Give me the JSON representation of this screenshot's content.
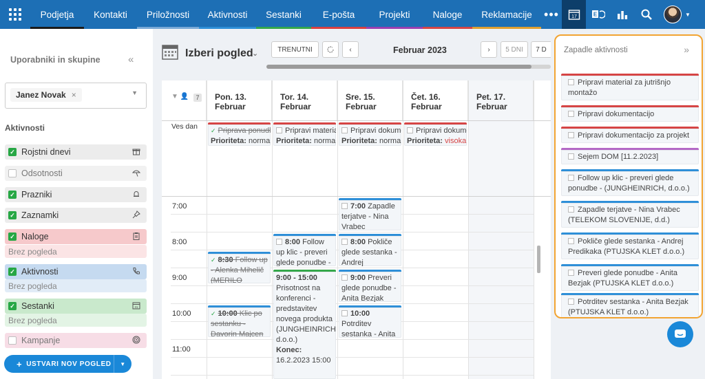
{
  "nav": {
    "items": [
      {
        "label": "Podjetja",
        "color": "#1a1a1a"
      },
      {
        "label": "Kontakti",
        "color": "#1d6fb5"
      },
      {
        "label": "Priložnosti",
        "color": "#7aa9d6"
      },
      {
        "label": "Aktivnosti",
        "color": "#2e8fd8"
      },
      {
        "label": "Sestanki",
        "color": "#35a84a"
      },
      {
        "label": "E-pošta",
        "color": "#d94040"
      },
      {
        "label": "Projekti",
        "color": "#9b3fb0"
      },
      {
        "label": "Naloge",
        "color": "#d64545"
      },
      {
        "label": "Reklamacije",
        "color": "#e0a030"
      }
    ],
    "more": "•••",
    "calendar_day": "17"
  },
  "sidebar": {
    "title": "Uporabniki in skupine",
    "collapse": "«",
    "selected_user": "Janez Novak",
    "remove": "×",
    "section": "Aktivnosti",
    "calendars": [
      {
        "label": "Rojstni dnevi",
        "checked": true,
        "icon": "gift-icon",
        "bg": "#ececec"
      },
      {
        "label": "Odsotnosti",
        "checked": false,
        "icon": "beach-umbrella-icon",
        "bg": "#f1f1f1"
      },
      {
        "label": "Prazniki",
        "checked": true,
        "icon": "bell-icon",
        "bg": "#ececec"
      },
      {
        "label": "Zaznamki",
        "checked": true,
        "icon": "pin-icon",
        "bg": "#ececec"
      },
      {
        "label": "Naloge",
        "checked": true,
        "icon": "clipboard-icon",
        "bg": "#f6c9cb",
        "sub": "Brez pogleda",
        "subbg": "#fbe4e5"
      },
      {
        "label": "Aktivnosti",
        "checked": true,
        "icon": "phone-icon",
        "bg": "#c5daf0",
        "sub": "Brez pogleda",
        "subbg": "#e1ecf7"
      },
      {
        "label": "Sestanki",
        "checked": true,
        "icon": "calendar-icon",
        "bg": "#c9e9cc",
        "sub": "Brez pogleda",
        "subbg": "#e3f4e5"
      },
      {
        "label": "Kampanje",
        "checked": false,
        "icon": "target-icon",
        "bg": "#f7dde6"
      }
    ],
    "new_view": "USTVARI NOV POGLED"
  },
  "main": {
    "view_title": "Izberi pogled",
    "today": "TRENUTNI",
    "month": "Februar 2023",
    "days_btn": "5 DNI",
    "seven_btn": "7 D",
    "user_count": "7",
    "all_day": "Ves dan",
    "days": [
      {
        "name": "Pon. 13.",
        "month": "Februar"
      },
      {
        "name": "Tor. 14.",
        "month": "Februar"
      },
      {
        "name": "Sre. 15.",
        "month": "Februar"
      },
      {
        "name": "Čet. 16.",
        "month": "Februar"
      },
      {
        "name": "Pet. 17.",
        "month": "Februar"
      }
    ],
    "times": [
      "7:00",
      "8:00",
      "9:00",
      "10:00",
      "11:00"
    ],
    "allday_events": [
      {
        "title": "Priprava ponudbe",
        "prio_label": "Prioriteta:",
        "prio": "normalna",
        "done": true
      },
      {
        "title": "Pripravi material",
        "prio_label": "Prioriteta:",
        "prio": "normalna",
        "done": false
      },
      {
        "title": "Pripravi dokumentacijo",
        "prio_label": "Prioriteta:",
        "prio": "normalna",
        "done": false
      },
      {
        "title": "Pripravi dokumentacijo",
        "prio_label": "Prioriteta:",
        "prio": "visoka",
        "done": false
      }
    ],
    "events": {
      "mon_830": {
        "time": "8:30",
        "text": "Follow up - Alenka Mihelič (MERILO"
      },
      "mon_1000": {
        "time": "10:00",
        "text": "Klic po sestanku - Davorin Majcen"
      },
      "tue_800": {
        "time": "8:00",
        "text": "Follow up klic - preveri glede ponudbe -"
      },
      "tue_900": {
        "time": "9:00 - 15:00",
        "text": "Prisotnost na konferenci - predstavitev novega produkta (JUNGHEINRICH, d.o.o.)",
        "end_label": "Konec:",
        "end": "16.2.2023 15:00"
      },
      "wed_700": {
        "time": "7:00",
        "text": "Zapadle terjatve - Nina Vrabec"
      },
      "wed_800": {
        "time": "8:00",
        "text": "Pokliče glede sestanka - Andrej"
      },
      "wed_900": {
        "time": "9:00",
        "text": "Preveri glede ponudbe - Anita Bezjak"
      },
      "wed_1000": {
        "time": "10:00",
        "text": "Potrditev sestanka - Anita"
      }
    }
  },
  "right_panel": {
    "title": "Zapadle aktivnosti",
    "collapse": "»",
    "items": [
      {
        "text": "Pripravi material za jutrišnjo montažo",
        "color": "#d64545"
      },
      {
        "text": "Pripravi dokumentacijo",
        "color": "#d64545"
      },
      {
        "text": "Pripravi dokumentacijo za projekt",
        "color": "#d64545"
      },
      {
        "text": "Sejem DOM [11.2.2023]",
        "color": "#b469c6"
      },
      {
        "text": "Follow up klic - preveri glede ponudbe - (JUNGHEINRICH, d.o.o.)",
        "color": "#2e8fd8"
      },
      {
        "text": "Zapadle terjatve - Nina Vrabec (TELEKOM SLOVENIJE, d.d.)",
        "color": "#2e8fd8"
      },
      {
        "text": "Pokliče glede sestanka - Andrej Predikaka (PTUJSKA KLET d.o.o.)",
        "color": "#2e8fd8"
      },
      {
        "text": "Preveri glede ponudbe - Anita Bezjak (PTUJSKA KLET d.o.o.)",
        "color": "#2e8fd8"
      },
      {
        "text": "Potrditev sestanka - Anita Bezjak (PTUJSKA KLET d.o.o.)",
        "color": "#2e8fd8"
      }
    ]
  }
}
